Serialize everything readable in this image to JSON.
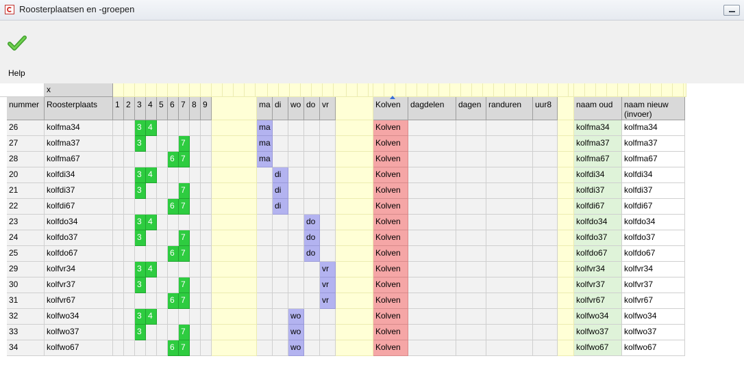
{
  "window": {
    "title": "Roosterplaatsen en -groepen"
  },
  "toolbar": {
    "help_label": "Help"
  },
  "grid": {
    "top_marker": "x",
    "headers": {
      "nummer": "nummer",
      "roosterplaats": "Roosterplaats",
      "hours": [
        "1",
        "2",
        "3",
        "4",
        "5",
        "6",
        "7",
        "8",
        "9"
      ],
      "days": [
        "ma",
        "di",
        "wo",
        "do",
        "vr"
      ],
      "kolven": "Kolven",
      "dagdelen": "dagdelen",
      "dagen": "dagen",
      "randuren": "randuren",
      "uur8": "uur8",
      "naam_oud": "naam oud",
      "naam_nieuw": "naam nieuw (invoer)"
    },
    "rows": [
      {
        "nummer": "26",
        "plaats": "kolfma34",
        "h3": "3",
        "h4": "4",
        "h6": "",
        "h7": "",
        "ma": "ma",
        "di": "",
        "wo": "",
        "do": "",
        "vr": "",
        "kolven": "Kolven",
        "oud": "kolfma34",
        "nieuw": "kolfma34"
      },
      {
        "nummer": "27",
        "plaats": "kolfma37",
        "h3": "3",
        "h4": "",
        "h6": "",
        "h7": "7",
        "ma": "ma",
        "di": "",
        "wo": "",
        "do": "",
        "vr": "",
        "kolven": "Kolven",
        "oud": "kolfma37",
        "nieuw": "kolfma37"
      },
      {
        "nummer": "28",
        "plaats": "kolfma67",
        "h3": "",
        "h4": "",
        "h6": "6",
        "h7": "7",
        "ma": "ma",
        "di": "",
        "wo": "",
        "do": "",
        "vr": "",
        "kolven": "Kolven",
        "oud": "kolfma67",
        "nieuw": "kolfma67"
      },
      {
        "nummer": "20",
        "plaats": "kolfdi34",
        "h3": "3",
        "h4": "4",
        "h6": "",
        "h7": "",
        "ma": "",
        "di": "di",
        "wo": "",
        "do": "",
        "vr": "",
        "kolven": "Kolven",
        "oud": "kolfdi34",
        "nieuw": "kolfdi34"
      },
      {
        "nummer": "21",
        "plaats": "kolfdi37",
        "h3": "3",
        "h4": "",
        "h6": "",
        "h7": "7",
        "ma": "",
        "di": "di",
        "wo": "",
        "do": "",
        "vr": "",
        "kolven": "Kolven",
        "oud": "kolfdi37",
        "nieuw": "kolfdi37"
      },
      {
        "nummer": "22",
        "plaats": "kolfdi67",
        "h3": "",
        "h4": "",
        "h6": "6",
        "h7": "7",
        "ma": "",
        "di": "di",
        "wo": "",
        "do": "",
        "vr": "",
        "kolven": "Kolven",
        "oud": "kolfdi67",
        "nieuw": "kolfdi67"
      },
      {
        "nummer": "23",
        "plaats": "kolfdo34",
        "h3": "3",
        "h4": "4",
        "h6": "",
        "h7": "",
        "ma": "",
        "di": "",
        "wo": "",
        "do": "do",
        "vr": "",
        "kolven": "Kolven",
        "oud": "kolfdo34",
        "nieuw": "kolfdo34"
      },
      {
        "nummer": "24",
        "plaats": "kolfdo37",
        "h3": "3",
        "h4": "",
        "h6": "",
        "h7": "7",
        "ma": "",
        "di": "",
        "wo": "",
        "do": "do",
        "vr": "",
        "kolven": "Kolven",
        "oud": "kolfdo37",
        "nieuw": "kolfdo37"
      },
      {
        "nummer": "25",
        "plaats": "kolfdo67",
        "h3": "",
        "h4": "",
        "h6": "6",
        "h7": "7",
        "ma": "",
        "di": "",
        "wo": "",
        "do": "do",
        "vr": "",
        "kolven": "Kolven",
        "oud": "kolfdo67",
        "nieuw": "kolfdo67"
      },
      {
        "nummer": "29",
        "plaats": "kolfvr34",
        "h3": "3",
        "h4": "4",
        "h6": "",
        "h7": "",
        "ma": "",
        "di": "",
        "wo": "",
        "do": "",
        "vr": "vr",
        "kolven": "Kolven",
        "oud": "kolfvr34",
        "nieuw": "kolfvr34"
      },
      {
        "nummer": "30",
        "plaats": "kolfvr37",
        "h3": "3",
        "h4": "",
        "h6": "",
        "h7": "7",
        "ma": "",
        "di": "",
        "wo": "",
        "do": "",
        "vr": "vr",
        "kolven": "Kolven",
        "oud": "kolfvr37",
        "nieuw": "kolfvr37"
      },
      {
        "nummer": "31",
        "plaats": "kolfvr67",
        "h3": "",
        "h4": "",
        "h6": "6",
        "h7": "7",
        "ma": "",
        "di": "",
        "wo": "",
        "do": "",
        "vr": "vr",
        "kolven": "Kolven",
        "oud": "kolfvr67",
        "nieuw": "kolfvr67"
      },
      {
        "nummer": "32",
        "plaats": "kolfwo34",
        "h3": "3",
        "h4": "4",
        "h6": "",
        "h7": "",
        "ma": "",
        "di": "",
        "wo": "wo",
        "do": "",
        "vr": "",
        "kolven": "Kolven",
        "oud": "kolfwo34",
        "nieuw": "kolfwo34"
      },
      {
        "nummer": "33",
        "plaats": "kolfwo37",
        "h3": "3",
        "h4": "",
        "h6": "",
        "h7": "7",
        "ma": "",
        "di": "",
        "wo": "wo",
        "do": "",
        "vr": "",
        "kolven": "Kolven",
        "oud": "kolfwo37",
        "nieuw": "kolfwo37"
      },
      {
        "nummer": "34",
        "plaats": "kolfwo67",
        "h3": "",
        "h4": "",
        "h6": "6",
        "h7": "7",
        "ma": "",
        "di": "",
        "wo": "wo",
        "do": "",
        "vr": "",
        "kolven": "Kolven",
        "oud": "kolfwo67",
        "nieuw": "kolfwo67"
      }
    ]
  },
  "colors": {
    "hour_active": "#2ecc40",
    "day_active": "#b3b3f0",
    "kolven": "#f5a6a6",
    "naam_oud_bg": "#dff3d9",
    "spacer_yellow": "#ffffd6"
  },
  "icons": {
    "app": "roster-app-icon",
    "confirm": "checkmark-icon",
    "minimize": "minimize-icon"
  }
}
